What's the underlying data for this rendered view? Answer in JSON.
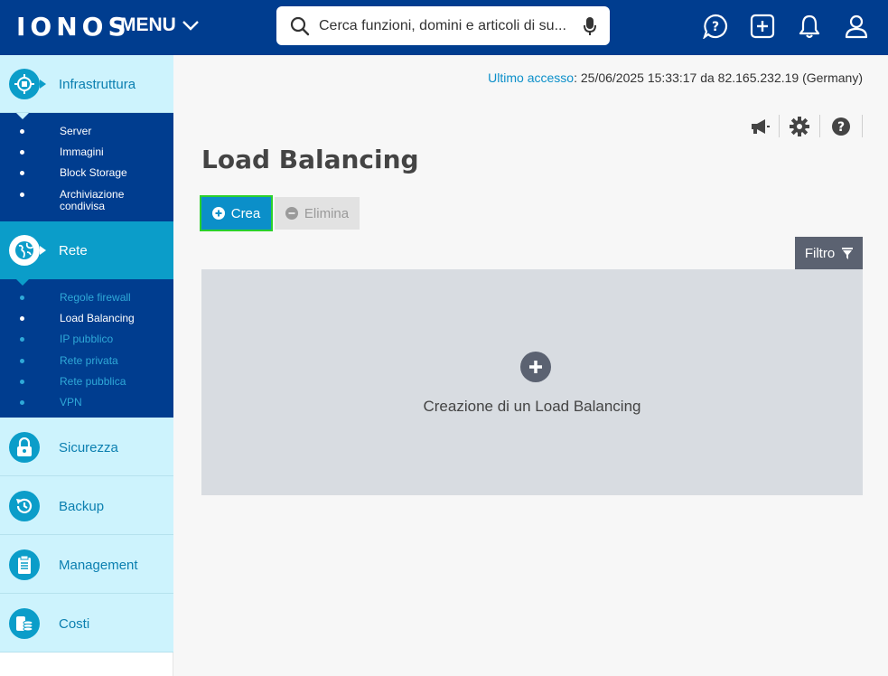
{
  "header": {
    "logo": "IONOS",
    "menu_label": "MENU",
    "search_placeholder": "Cerca funzioni, domini e articoli di su..."
  },
  "sidebar": {
    "infrastruttura": {
      "label": "Infrastruttura",
      "items": [
        "Server",
        "Immagini",
        "Block Storage",
        "Archiviazione\ncondivisa"
      ]
    },
    "rete": {
      "label": "Rete",
      "items": [
        "Regole firewall",
        "Load Balancing",
        "IP pubblico",
        "Rete privata",
        "Rete pubblica",
        "VPN"
      ],
      "current": "Load Balancing"
    },
    "sicurezza": "Sicurezza",
    "backup": "Backup",
    "management": "Management",
    "costi": "Costi"
  },
  "main": {
    "last_access_label": "Ultimo accesso",
    "last_access_value": ": 25/06/2025 15:33:17 da 82.165.232.19 (Germany)",
    "title": "Load Balancing",
    "create_label": "Crea",
    "delete_label": "Elimina",
    "filter_label": "Filtro",
    "empty_label": "Creazione di un Load Balancing"
  },
  "colors": {
    "header_bg": "#003d8f",
    "accent": "#0b8fc9",
    "active_section": "#0b9dc9",
    "light_section": "#cdf3fd",
    "focus_outline": "#2bd12b"
  }
}
